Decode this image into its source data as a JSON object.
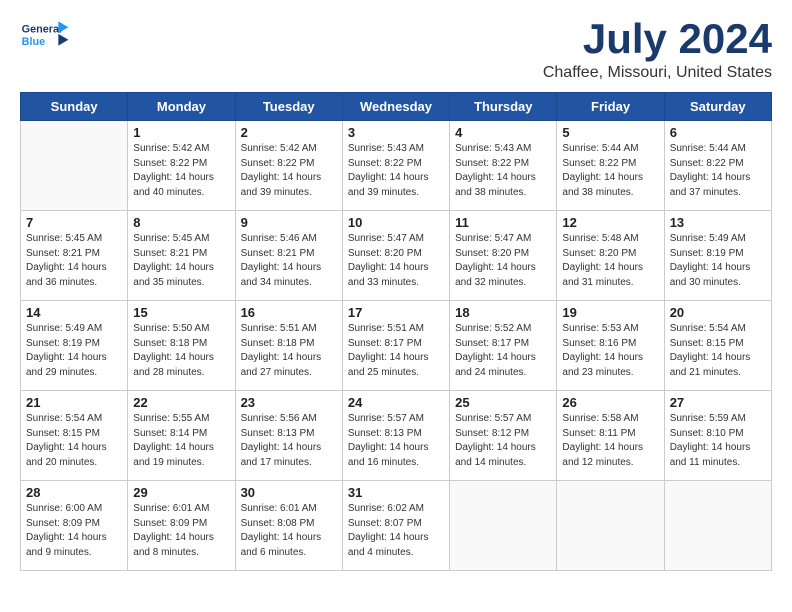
{
  "header": {
    "logo_general": "General",
    "logo_blue": "Blue",
    "title": "July 2024",
    "subtitle": "Chaffee, Missouri, United States"
  },
  "days_of_week": [
    "Sunday",
    "Monday",
    "Tuesday",
    "Wednesday",
    "Thursday",
    "Friday",
    "Saturday"
  ],
  "weeks": [
    [
      {
        "num": "",
        "info": ""
      },
      {
        "num": "1",
        "info": "Sunrise: 5:42 AM\nSunset: 8:22 PM\nDaylight: 14 hours\nand 40 minutes."
      },
      {
        "num": "2",
        "info": "Sunrise: 5:42 AM\nSunset: 8:22 PM\nDaylight: 14 hours\nand 39 minutes."
      },
      {
        "num": "3",
        "info": "Sunrise: 5:43 AM\nSunset: 8:22 PM\nDaylight: 14 hours\nand 39 minutes."
      },
      {
        "num": "4",
        "info": "Sunrise: 5:43 AM\nSunset: 8:22 PM\nDaylight: 14 hours\nand 38 minutes."
      },
      {
        "num": "5",
        "info": "Sunrise: 5:44 AM\nSunset: 8:22 PM\nDaylight: 14 hours\nand 38 minutes."
      },
      {
        "num": "6",
        "info": "Sunrise: 5:44 AM\nSunset: 8:22 PM\nDaylight: 14 hours\nand 37 minutes."
      }
    ],
    [
      {
        "num": "7",
        "info": "Sunrise: 5:45 AM\nSunset: 8:21 PM\nDaylight: 14 hours\nand 36 minutes."
      },
      {
        "num": "8",
        "info": "Sunrise: 5:45 AM\nSunset: 8:21 PM\nDaylight: 14 hours\nand 35 minutes."
      },
      {
        "num": "9",
        "info": "Sunrise: 5:46 AM\nSunset: 8:21 PM\nDaylight: 14 hours\nand 34 minutes."
      },
      {
        "num": "10",
        "info": "Sunrise: 5:47 AM\nSunset: 8:20 PM\nDaylight: 14 hours\nand 33 minutes."
      },
      {
        "num": "11",
        "info": "Sunrise: 5:47 AM\nSunset: 8:20 PM\nDaylight: 14 hours\nand 32 minutes."
      },
      {
        "num": "12",
        "info": "Sunrise: 5:48 AM\nSunset: 8:20 PM\nDaylight: 14 hours\nand 31 minutes."
      },
      {
        "num": "13",
        "info": "Sunrise: 5:49 AM\nSunset: 8:19 PM\nDaylight: 14 hours\nand 30 minutes."
      }
    ],
    [
      {
        "num": "14",
        "info": "Sunrise: 5:49 AM\nSunset: 8:19 PM\nDaylight: 14 hours\nand 29 minutes."
      },
      {
        "num": "15",
        "info": "Sunrise: 5:50 AM\nSunset: 8:18 PM\nDaylight: 14 hours\nand 28 minutes."
      },
      {
        "num": "16",
        "info": "Sunrise: 5:51 AM\nSunset: 8:18 PM\nDaylight: 14 hours\nand 27 minutes."
      },
      {
        "num": "17",
        "info": "Sunrise: 5:51 AM\nSunset: 8:17 PM\nDaylight: 14 hours\nand 25 minutes."
      },
      {
        "num": "18",
        "info": "Sunrise: 5:52 AM\nSunset: 8:17 PM\nDaylight: 14 hours\nand 24 minutes."
      },
      {
        "num": "19",
        "info": "Sunrise: 5:53 AM\nSunset: 8:16 PM\nDaylight: 14 hours\nand 23 minutes."
      },
      {
        "num": "20",
        "info": "Sunrise: 5:54 AM\nSunset: 8:15 PM\nDaylight: 14 hours\nand 21 minutes."
      }
    ],
    [
      {
        "num": "21",
        "info": "Sunrise: 5:54 AM\nSunset: 8:15 PM\nDaylight: 14 hours\nand 20 minutes."
      },
      {
        "num": "22",
        "info": "Sunrise: 5:55 AM\nSunset: 8:14 PM\nDaylight: 14 hours\nand 19 minutes."
      },
      {
        "num": "23",
        "info": "Sunrise: 5:56 AM\nSunset: 8:13 PM\nDaylight: 14 hours\nand 17 minutes."
      },
      {
        "num": "24",
        "info": "Sunrise: 5:57 AM\nSunset: 8:13 PM\nDaylight: 14 hours\nand 16 minutes."
      },
      {
        "num": "25",
        "info": "Sunrise: 5:57 AM\nSunset: 8:12 PM\nDaylight: 14 hours\nand 14 minutes."
      },
      {
        "num": "26",
        "info": "Sunrise: 5:58 AM\nSunset: 8:11 PM\nDaylight: 14 hours\nand 12 minutes."
      },
      {
        "num": "27",
        "info": "Sunrise: 5:59 AM\nSunset: 8:10 PM\nDaylight: 14 hours\nand 11 minutes."
      }
    ],
    [
      {
        "num": "28",
        "info": "Sunrise: 6:00 AM\nSunset: 8:09 PM\nDaylight: 14 hours\nand 9 minutes."
      },
      {
        "num": "29",
        "info": "Sunrise: 6:01 AM\nSunset: 8:09 PM\nDaylight: 14 hours\nand 8 minutes."
      },
      {
        "num": "30",
        "info": "Sunrise: 6:01 AM\nSunset: 8:08 PM\nDaylight: 14 hours\nand 6 minutes."
      },
      {
        "num": "31",
        "info": "Sunrise: 6:02 AM\nSunset: 8:07 PM\nDaylight: 14 hours\nand 4 minutes."
      },
      {
        "num": "",
        "info": ""
      },
      {
        "num": "",
        "info": ""
      },
      {
        "num": "",
        "info": ""
      }
    ]
  ]
}
